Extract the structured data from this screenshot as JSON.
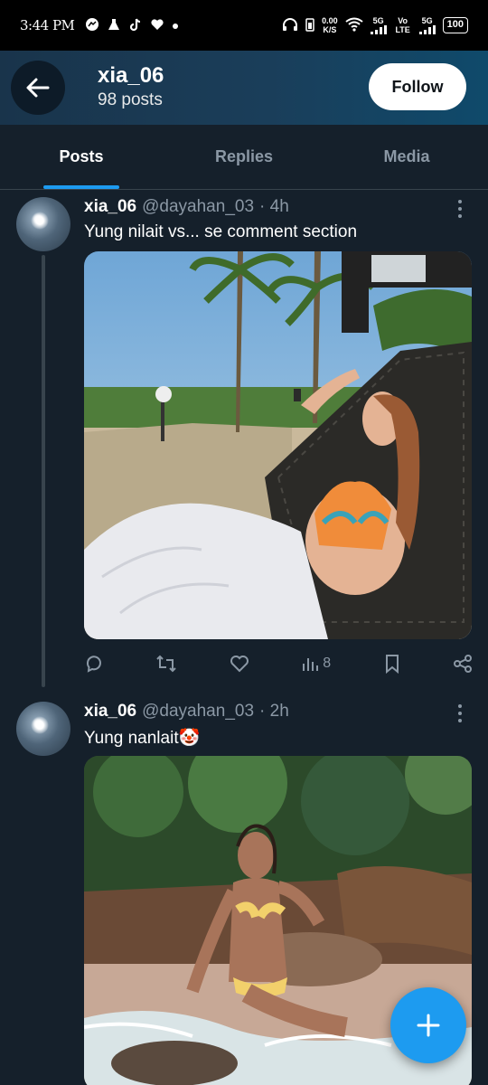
{
  "status_bar": {
    "time": "3:44 PM",
    "net_speed_value": "0.00",
    "net_speed_unit": "K/S",
    "signal_1": "5G",
    "volte": "Vo LTE",
    "signal_2": "5G",
    "battery": "100"
  },
  "header": {
    "name": "xia_06",
    "post_count": "98 posts",
    "follow_label": "Follow"
  },
  "tabs": [
    {
      "label": "Posts",
      "active": true
    },
    {
      "label": "Replies",
      "active": false
    },
    {
      "label": "Media",
      "active": false
    }
  ],
  "posts": [
    {
      "username": "xia_06",
      "handle": "@dayahan_03",
      "time": "· 4h",
      "text": "Yung nilait vs... se comment section",
      "views": "8"
    },
    {
      "username": "xia_06",
      "handle": "@dayahan_03",
      "time": "· 2h",
      "text": "Yung nanlait🤡"
    }
  ],
  "icons": {
    "back": "arrow-left-icon",
    "more": "more-vertical-icon",
    "reply": "comment-icon",
    "retweet": "retweet-icon",
    "like": "heart-icon",
    "views": "bar-chart-icon",
    "bookmark": "bookmark-icon",
    "share": "share-icon",
    "compose": "plus-icon"
  },
  "colors": {
    "accent": "#1d9bf0",
    "background": "#15202b",
    "muted": "#8b98a5"
  }
}
